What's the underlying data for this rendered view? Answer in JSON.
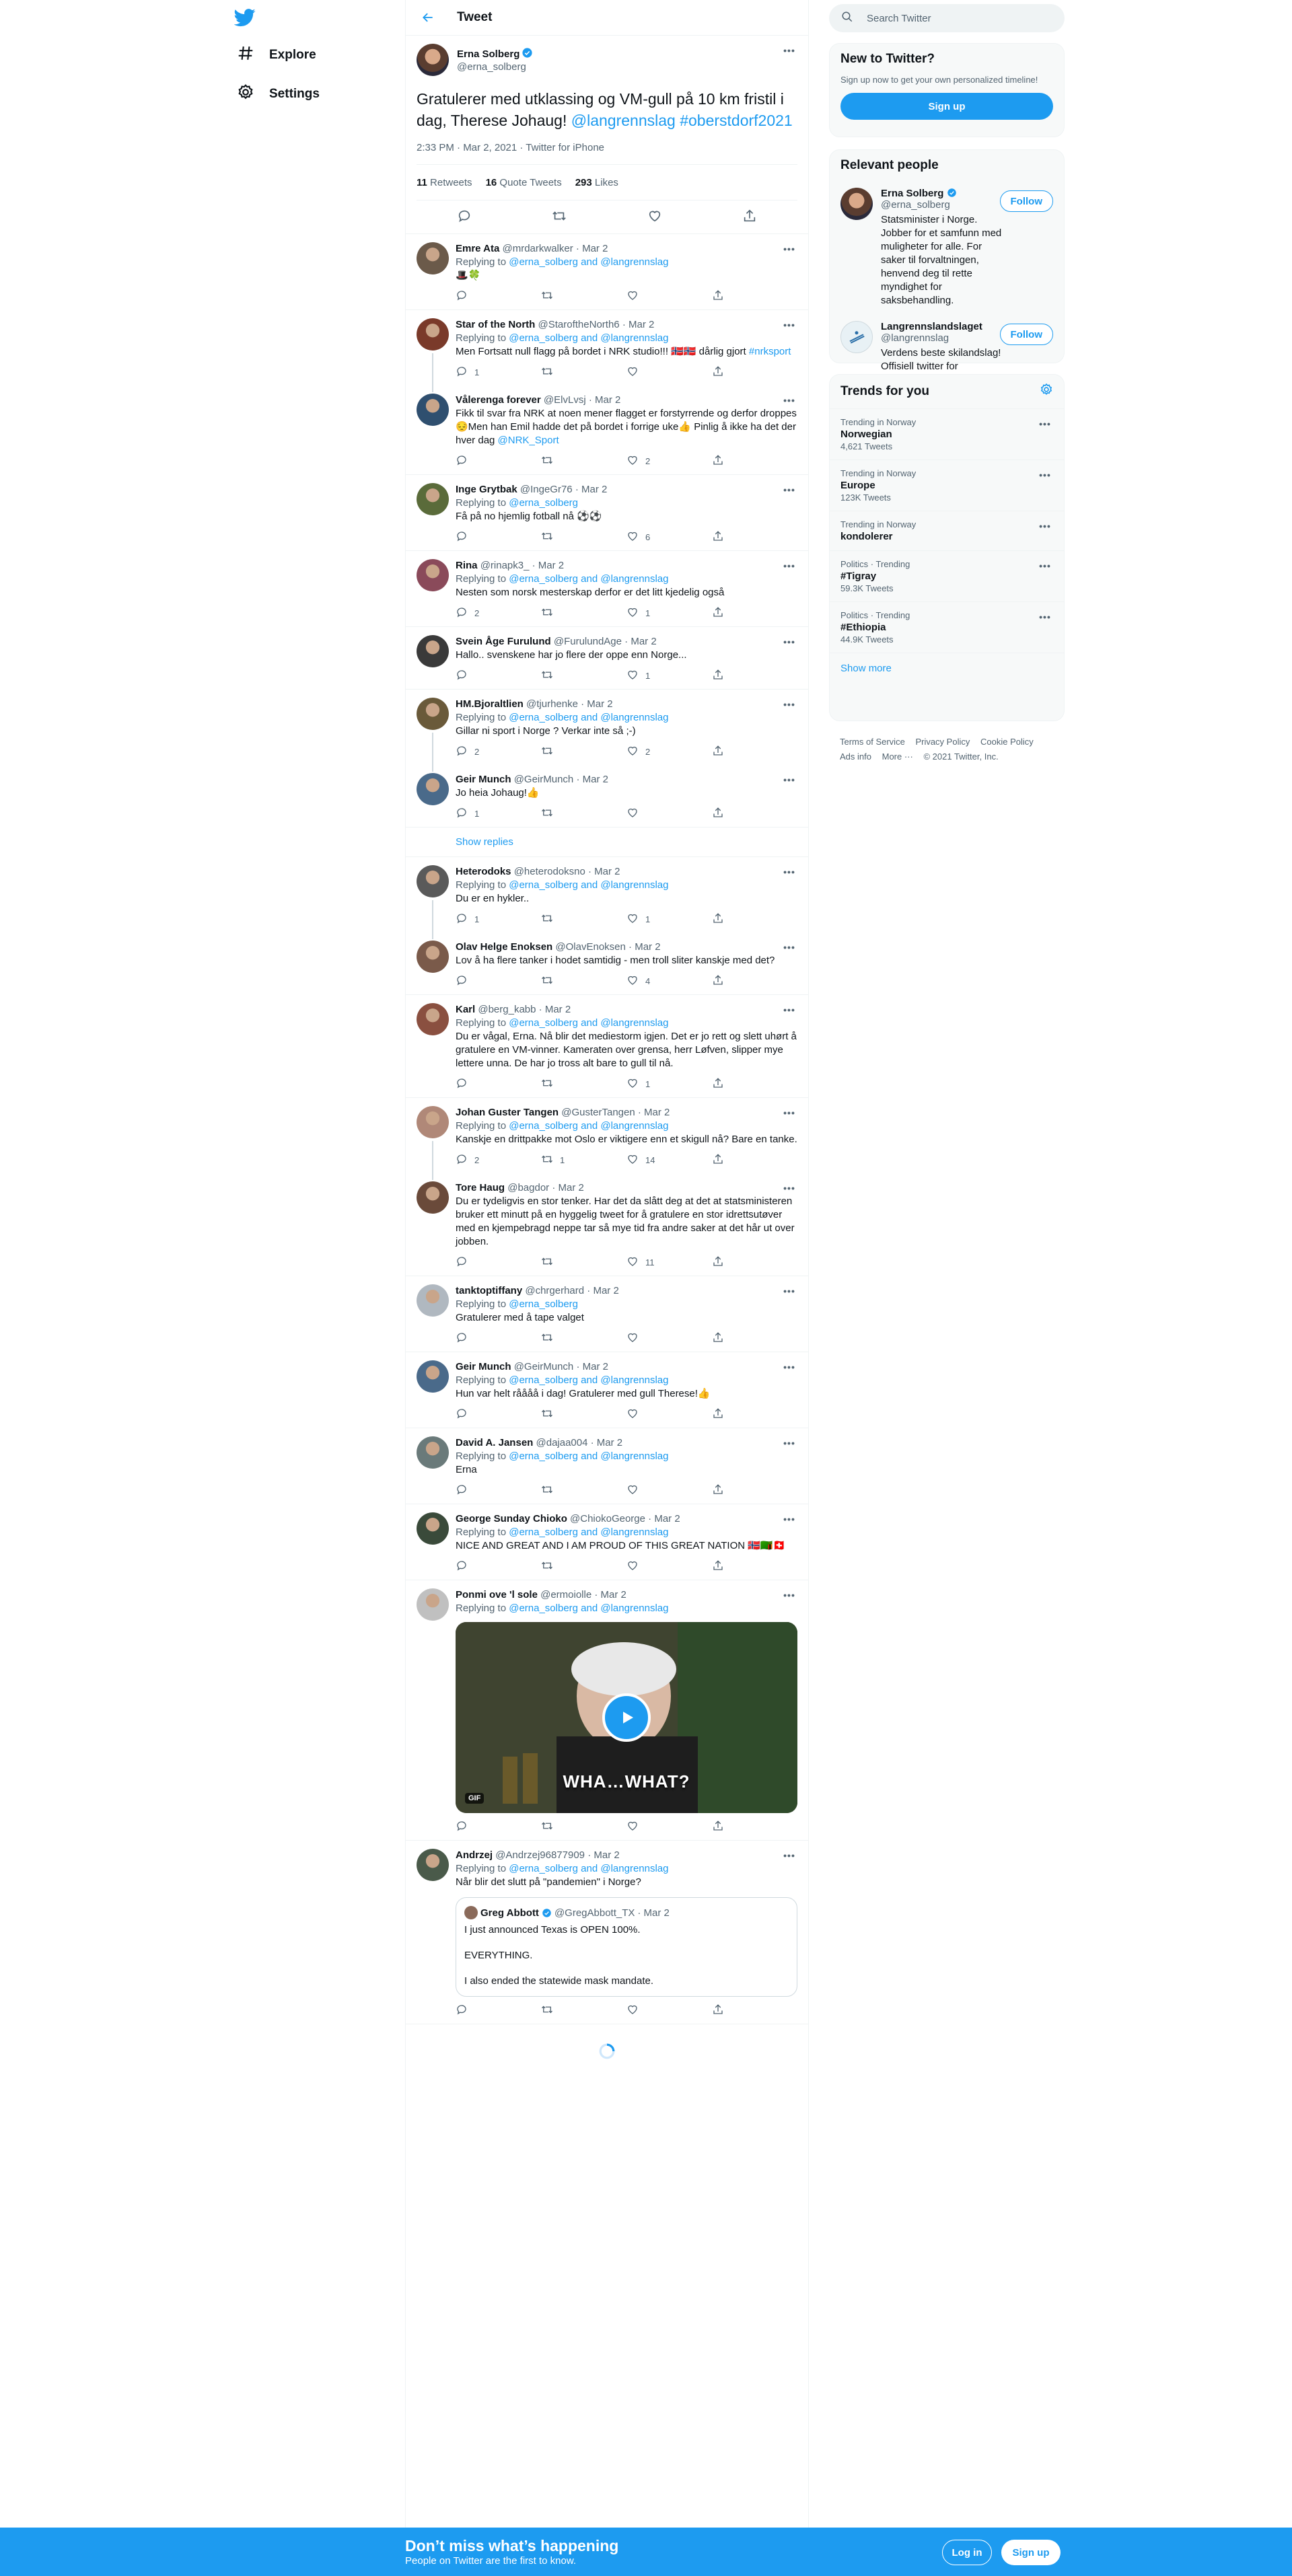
{
  "nav": {
    "explore": "Explore",
    "settings": "Settings"
  },
  "header": {
    "title": "Tweet"
  },
  "focal": {
    "name": "Erna Solberg",
    "handle": "@erna_solberg",
    "text_plain": "Gratulerer med utklassing og VM-gull på 10 km fristil i dag, Therese Johaug! ",
    "mention": "@langrennslag",
    "hashtag": "#oberstdorf2021",
    "meta": "2:33 PM · Mar 2, 2021 · Twitter for iPhone",
    "retweets": "11",
    "retweets_label": "Retweets",
    "quotes": "16",
    "quotes_label": "Quote Tweets",
    "likes": "293",
    "likes_label": "Likes"
  },
  "replies": [
    {
      "name": "Emre Ata",
      "handle": "@mrdarkwalker",
      "date": "· Mar 2",
      "replying": "Replying to",
      "to": "@erna_solberg and @langrennslag",
      "text": "🎩🍀",
      "c": "",
      "r": "",
      "l": ""
    },
    {
      "name": "Star of the North",
      "handle": "@StaroftheNorth6",
      "date": "· Mar 2",
      "replying": "Replying to",
      "to": "@erna_solberg and @langrennslag",
      "text": "Men Fortsatt null flagg på bordet i NRK studio!!! 🇳🇴🇳🇴 dårlig gjort ",
      "tag": "#nrksport",
      "c": "1",
      "r": "",
      "l": ""
    },
    {
      "name": "Vålerenga forever",
      "handle": "@ElvLvsj",
      "date": "· Mar 2",
      "text": "Fikk til svar fra NRK at noen mener flagget er forstyrrende og derfor droppes 😔Men han Emil hadde det på bordet i forrige uke👍 Pinlig å ikke ha det der hver dag ",
      "tag": "@NRK_Sport",
      "c": "",
      "r": "",
      "l": "2"
    },
    {
      "name": "Inge Grytbak",
      "handle": "@IngeGr76",
      "date": "· Mar 2",
      "replying": "Replying to",
      "to": "@erna_solberg",
      "text": "Få på no hjemlig fotball nå ⚽⚽",
      "c": "",
      "r": "",
      "l": "6"
    },
    {
      "name": "Rina",
      "handle": "@rinapk3_",
      "date": "· Mar 2",
      "replying": "Replying to",
      "to": "@erna_solberg and @langrennslag",
      "text": "Nesten som norsk mesterskap  derfor er det litt kjedelig også",
      "c": "2",
      "r": "",
      "l": "1"
    },
    {
      "name": "Svein Åge Furulund",
      "handle": "@FurulundAge",
      "date": "· Mar 2",
      "text": "Hallo.. svenskene har jo flere der oppe enn Norge...",
      "c": "",
      "r": "",
      "l": "1"
    },
    {
      "name": "HM.Bjoraltlien",
      "handle": "@tjurhenke",
      "date": "· Mar 2",
      "replying": "Replying to",
      "to": "@erna_solberg and @langrennslag",
      "text": "Gillar ni sport i Norge ? Verkar inte så ;-)",
      "c": "2",
      "r": "",
      "l": "2"
    },
    {
      "name": "Geir Munch",
      "handle": "@GeirMunch",
      "date": "· Mar 2",
      "text": "Jo heia Johaug!👍",
      "c": "1",
      "r": "",
      "l": ""
    },
    {
      "name": "Heterodoks",
      "handle": "@heterodoksno",
      "date": "· Mar 2",
      "replying": "Replying to",
      "to": "@erna_solberg and @langrennslag",
      "text": "Du er en hykler..",
      "c": "1",
      "r": "",
      "l": "1"
    },
    {
      "name": "Olav Helge Enoksen",
      "handle": "@OlavEnoksen",
      "date": "· Mar 2",
      "text": "Lov å ha flere tanker i hodet samtidig - men troll sliter kanskje med det?",
      "c": "",
      "r": "",
      "l": "4"
    },
    {
      "name": "Karl",
      "handle": "@berg_kabb",
      "date": "· Mar 2",
      "replying": "Replying to",
      "to": "@erna_solberg and @langrennslag",
      "text": "Du er vågal, Erna.  Nå blir det mediestorm igjen.  Det er jo rett og slett uhørt å gratulere en VM-vinner.  Kameraten over grensa, herr Løfven, slipper mye lettere unna.  De har jo tross alt bare to gull til nå.",
      "c": "",
      "r": "",
      "l": "1"
    },
    {
      "name": "Johan Guster Tangen",
      "handle": "@GusterTangen",
      "date": "· Mar 2",
      "replying": "Replying to",
      "to": "@erna_solberg and @langrennslag",
      "text": "Kanskje en drittpakke mot Oslo er viktigere enn et skigull nå? Bare en tanke.",
      "c": "2",
      "r": "1",
      "l": "14"
    },
    {
      "name": "Tore Haug",
      "handle": "@bagdor",
      "date": "· Mar 2",
      "text": "Du er tydeligvis en stor tenker. Har det da slått deg at det at statsministeren bruker ett minutt på en hyggelig tweet for å gratulere en stor idrettsutøver med en kjempebragd neppe tar så mye tid fra andre saker at det hår ut over jobben.",
      "c": "",
      "r": "",
      "l": "11"
    },
    {
      "name": "tanktoptiffany",
      "handle": "@chrgerhard",
      "date": "· Mar 2",
      "replying": "Replying to",
      "to": "@erna_solberg",
      "text": "Gratulerer med å tape valget",
      "c": "",
      "r": "",
      "l": ""
    },
    {
      "name": "Geir Munch",
      "handle": "@GeirMunch",
      "date": "· Mar 2",
      "replying": "Replying to",
      "to": "@erna_solberg and @langrennslag",
      "text": "Hun var helt råååå i dag! Gratulerer med gull Therese!👍",
      "c": "",
      "r": "",
      "l": ""
    },
    {
      "name": "David A. Jansen",
      "handle": "@dajaa004",
      "date": "· Mar 2",
      "replying": "Replying to",
      "to": "@erna_solberg and @langrennslag",
      "text": "Erna",
      "c": "",
      "r": "",
      "l": ""
    },
    {
      "name": "George Sunday Chioko",
      "handle": "@ChiokoGeorge",
      "date": "· Mar 2",
      "replying": "Replying to",
      "to": "@erna_solberg and @langrennslag",
      "text": "NICE AND GREAT AND I AM PROUD OF THIS GREAT NATION 🇳🇴🇿🇲🇨🇭",
      "c": "",
      "r": "",
      "l": ""
    },
    {
      "name": "Ponmi ove 'l sole",
      "handle": "@ermoiolle",
      "date": "· Mar 2",
      "replying": "Replying to",
      "to": "@erna_solberg and @langrennslag",
      "text": "",
      "media_caption": "WHA…WHAT?",
      "media_badge": "GIF",
      "c": "",
      "r": "",
      "l": ""
    },
    {
      "name": "Andrzej",
      "handle": "@Andrzej96877909",
      "date": "· Mar 2",
      "replying": "Replying to",
      "to": "@erna_solberg and @langrennslag",
      "text": "Når blir det slutt på \"pandemien\" i Norge?",
      "c": "",
      "r": "",
      "l": ""
    }
  ],
  "show_replies": "Show replies",
  "quote": {
    "name": "Greg Abbott",
    "handle": "@GregAbbott_TX",
    "date": "· Mar 2",
    "line1": "I just announced Texas is OPEN 100%.",
    "line2": "EVERYTHING.",
    "line3": "I also ended the statewide mask mandate."
  },
  "right": {
    "search_placeholder": "Search Twitter",
    "new_title": "New to Twitter?",
    "new_sub": "Sign up now to get your own personalized timeline!",
    "signup": "Sign up",
    "relevant_title": "Relevant people",
    "people": [
      {
        "name": "Erna Solberg",
        "handle": "@erna_solberg",
        "bio": "Statsminister i Norge. Jobber for et samfunn med muligheter for alle. For saker til forvaltningen, henvend deg til rette myndighet for saksbehandling.",
        "follow": "Follow"
      },
      {
        "name": "Langrennslandslaget",
        "handle": "@langrennslag",
        "bio": "Verdens beste skilandslag! Offisiell twitter for langrennslagene i Norges Skiforbund.",
        "follow": "Follow"
      }
    ],
    "trends_title": "Trends for you",
    "trends": [
      {
        "ctx": "Trending in Norway",
        "name": "Norwegian",
        "count": "4,621 Tweets"
      },
      {
        "ctx": "Trending in Norway",
        "name": "Europe",
        "count": "123K Tweets"
      },
      {
        "ctx": "Trending in Norway",
        "name": "kondolerer",
        "count": ""
      },
      {
        "ctx": "Politics · Trending",
        "name": "#Tigray",
        "count": "59.3K Tweets"
      },
      {
        "ctx": "Politics · Trending",
        "name": "#Ethiopia",
        "count": "44.9K Tweets"
      }
    ],
    "show_more": "Show more",
    "footer": [
      "Terms of Service",
      "Privacy Policy",
      "Cookie Policy",
      "Ads info",
      "More ···",
      "© 2021 Twitter, Inc."
    ]
  },
  "bottom": {
    "title": "Don’t miss what’s happening",
    "sub": "People on Twitter are the first to know.",
    "login": "Log in",
    "signup": "Sign up"
  },
  "colors": {
    "accent": "#1d9bf0",
    "text": "#0f1419",
    "muted": "#536471",
    "border": "#eff3f4"
  }
}
